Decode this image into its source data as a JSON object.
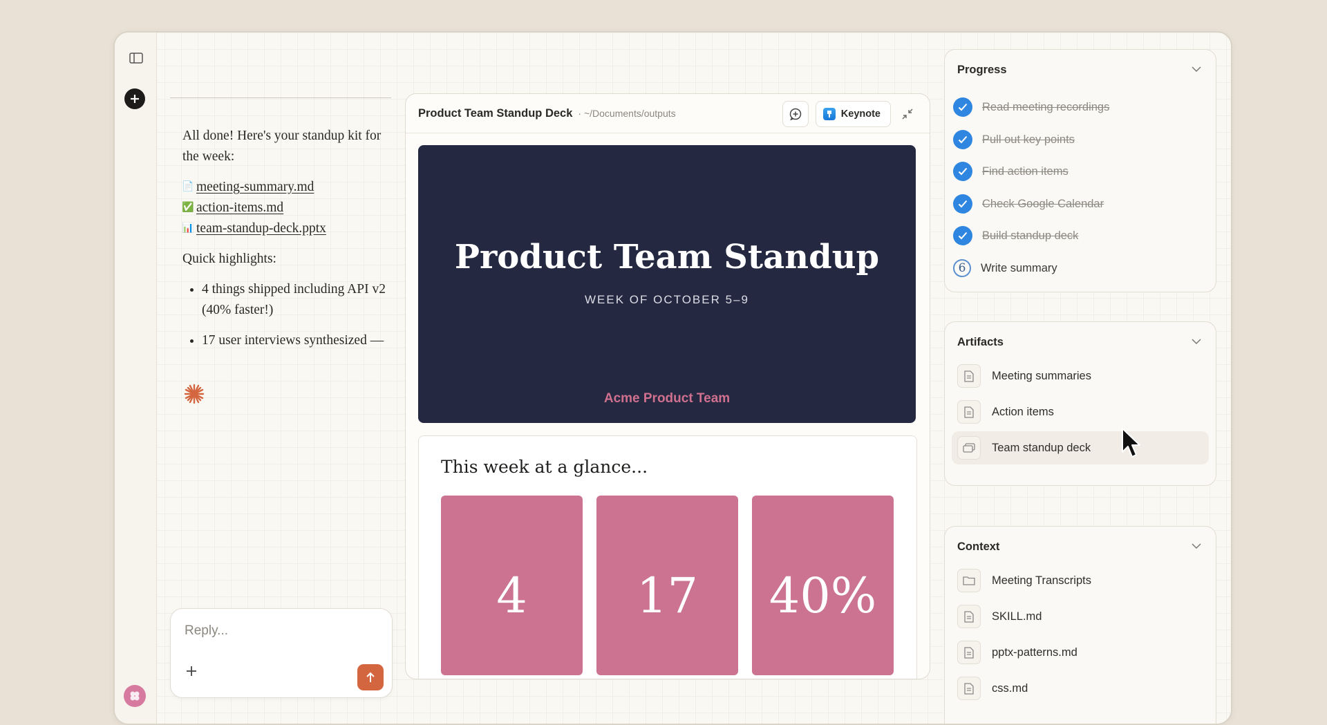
{
  "chat": {
    "intro": "All done! Here's your standup kit for the week:",
    "files": [
      {
        "icon": "📄",
        "name": "meeting-summary.md"
      },
      {
        "icon": "✅",
        "name": "action-items.md"
      },
      {
        "icon": "📊",
        "name": "team-standup-deck.pptx"
      }
    ],
    "highlights_heading": "Quick highlights:",
    "highlights": [
      "4 things shipped including API v2 (40% faster!)",
      "17 user interviews synthesized —"
    ],
    "reply_placeholder": "Reply..."
  },
  "preview": {
    "title": "Product Team Standup Deck",
    "path": "· ~/Documents/outputs",
    "open_with_label": "Keynote",
    "slide1": {
      "title": "Product Team Standup",
      "subtitle": "WEEK OF OCTOBER 5–9",
      "team": "Acme Product Team"
    },
    "slide2": {
      "title": "This week at a glance...",
      "stats": [
        "4",
        "17",
        "40%"
      ]
    }
  },
  "progress": {
    "heading": "Progress",
    "tasks": [
      {
        "label": "Read meeting recordings",
        "done": true
      },
      {
        "label": "Pull out key points",
        "done": true
      },
      {
        "label": "Find action items",
        "done": true
      },
      {
        "label": "Check Google Calendar",
        "done": true
      },
      {
        "label": "Build standup deck",
        "done": true
      },
      {
        "label": "Write summary",
        "done": false,
        "step": "6"
      }
    ]
  },
  "artifacts": {
    "heading": "Artifacts",
    "items": [
      "Meeting summaries",
      "Action items",
      "Team standup deck"
    ]
  },
  "context": {
    "heading": "Context",
    "items": [
      "Meeting Transcripts",
      "SKILL.md",
      "pptx-patterns.md",
      "css.md"
    ]
  },
  "colors": {
    "accent_orange": "#d4663f",
    "slide_navy": "#242840",
    "stat_pink": "#cb7390",
    "check_blue": "#2f86e0"
  }
}
